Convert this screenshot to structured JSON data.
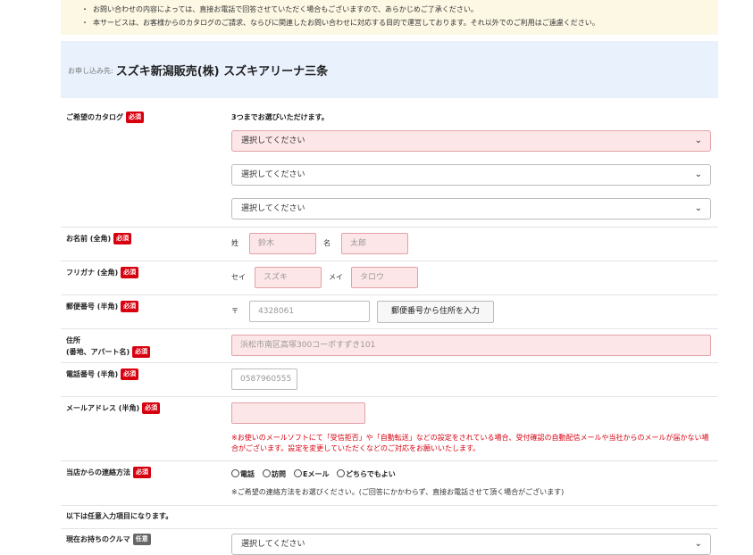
{
  "notices": [
    "お問い合わせの内容によっては、直接お電話で回答させていただく場合もございますので、あらかじめご了承ください。",
    "本サービスは、お客様からのカタログのご請求、ならびに関連したお問い合わせに対応する目的で運営しております。それ以外でのご利用はご遠慮ください。"
  ],
  "shop": {
    "prefix": "お申し込み先:",
    "name": "スズキ新潟販売(株) スズキアリーナ三条"
  },
  "badges": {
    "required": "必須",
    "optional": "任意"
  },
  "catalog": {
    "label": "ご希望のカタログ",
    "hint": "3つまでお選びいただけます。",
    "select_placeholder": "選択してください",
    "chevron": "⌄"
  },
  "name": {
    "label": "お名前 (全角)",
    "last_prefix": "姓",
    "last_placeholder": "鈴木",
    "first_prefix": "名",
    "first_placeholder": "太郎"
  },
  "kana": {
    "label": "フリガナ (全角)",
    "last_prefix": "セイ",
    "last_placeholder": "スズキ",
    "first_prefix": "メイ",
    "first_placeholder": "タロウ"
  },
  "postal": {
    "label": "郵便番号 (半角)",
    "prefix": "〒",
    "placeholder": "4328061",
    "lookup_button": "郵便番号から住所を入力"
  },
  "address": {
    "label_line1": "住所",
    "label_line2": "(番地、アパート名)",
    "placeholder": "浜松市南区高塚300コーポすずき101"
  },
  "phone": {
    "label": "電話番号 (半角)",
    "placeholder": "0587960555"
  },
  "email": {
    "label": "メールアドレス (半角)",
    "warning": "※お使いのメールソフトにて「受信拒否」や「自動転送」などの設定をされている場合、受付確認の自動配信メールや当社からのメールが届かない場合がございます。設定を変更していただくなどのご対応をお願いいたします。"
  },
  "contact": {
    "label": "当店からの連絡方法",
    "options": [
      "電話",
      "訪問",
      "Eメール",
      "どちらでもよい"
    ],
    "note": "※ご希望の連絡方法をお選びください。(ご回答にかかわらず、直接お電話させて頂く場合がございます)"
  },
  "optional_section": {
    "heading": "以下は任意入力項目になります。"
  },
  "current_car": {
    "label": "現在お持ちのクルマ",
    "placeholder": "選択してください"
  }
}
